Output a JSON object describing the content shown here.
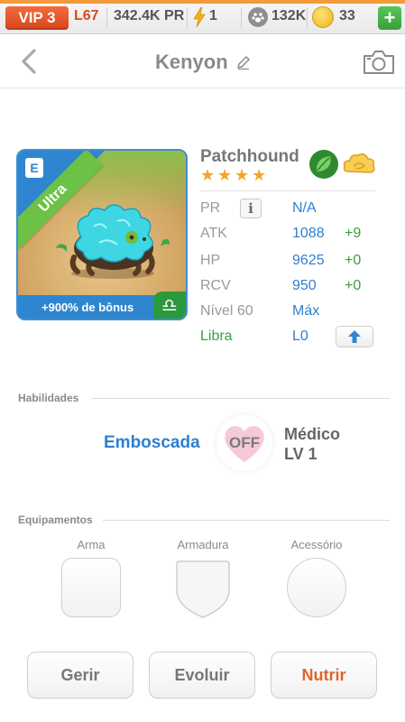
{
  "status_bar": {
    "vip_label": "VIP 3",
    "player_level": "L67",
    "power_rating": "342.4K PR",
    "energy": "1",
    "pet_food": "132K",
    "gold": "33",
    "add_label": "+",
    "accent_color": "#f36b3c"
  },
  "header": {
    "title": "Kenyon",
    "back_icon": "chevron-left-icon",
    "edit_icon": "pencil-icon",
    "camera_icon": "camera-icon"
  },
  "pet_card": {
    "rarity": "Ultra",
    "bonus_text": "+900% de bônus",
    "zodiac_symbol": "♎",
    "equip_badge": "E"
  },
  "pet": {
    "name": "Patchhound",
    "star_count": 4,
    "element_icons": [
      "leaf-element-icon",
      "cloud-element-icon"
    ]
  },
  "stats": [
    {
      "label": "PR",
      "value": "N/A",
      "bonus": "",
      "info": "i"
    },
    {
      "label": "ATK",
      "value": "1088",
      "bonus": "+9"
    },
    {
      "label": "HP",
      "value": "9625",
      "bonus": "+0"
    },
    {
      "label": "RCV",
      "value": "950",
      "bonus": "+0"
    },
    {
      "label": "Nível 60",
      "value": "Máx",
      "bonus": ""
    },
    {
      "label": "Libra",
      "value": "L0",
      "bonus": ""
    }
  ],
  "abilities": {
    "section_title": "Habilidades",
    "name": "Emboscada",
    "toggle_state": "OFF",
    "tier": "Médico",
    "level": "LV 1"
  },
  "equipment": {
    "section_title": "Equipamentos",
    "slots": [
      {
        "label": "Arma"
      },
      {
        "label": "Armadura"
      },
      {
        "label": "Acessório"
      }
    ]
  },
  "actions": {
    "manage": "Gerir",
    "evolve": "Evoluir",
    "feed": "Nutrir"
  }
}
